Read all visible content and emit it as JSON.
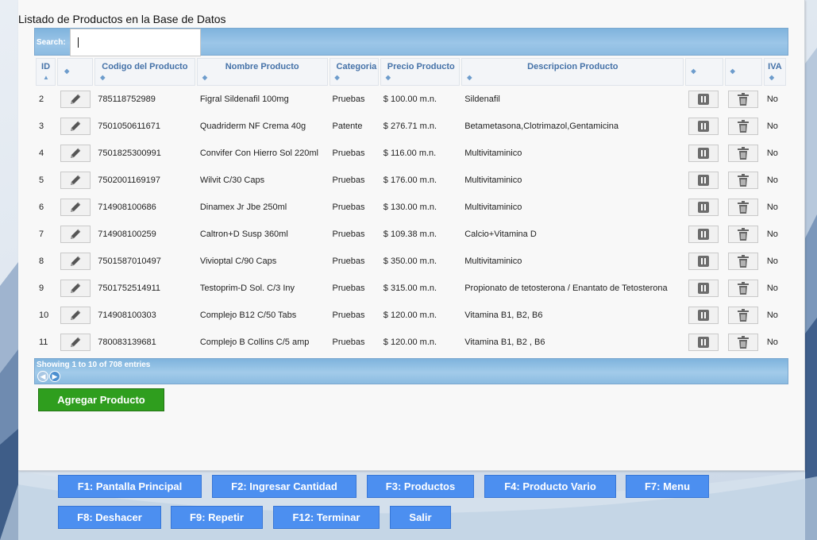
{
  "panel": {
    "title": "Listado de Productos en la Base de Datos",
    "search_label": "Search:",
    "search_value": ""
  },
  "table": {
    "headers": {
      "id": "ID",
      "codigo": "Codigo del Producto",
      "nombre": "Nombre Producto",
      "categoria": "Categoria",
      "precio": "Precio Producto",
      "descripcion": "Descripcion Producto",
      "iva": "IVA"
    },
    "rows": [
      {
        "id": "2",
        "codigo": "785118752989",
        "nombre": "Figral Sildenafil 100mg",
        "categoria": "Pruebas",
        "precio": "$ 100.00 m.n.",
        "descripcion": "Sildenafil",
        "iva": "No"
      },
      {
        "id": "3",
        "codigo": "7501050611671",
        "nombre": "Quadriderm NF Crema 40g",
        "categoria": "Patente",
        "precio": "$ 276.71 m.n.",
        "descripcion": "Betametasona,Clotrimazol,Gentamicina",
        "iva": "No"
      },
      {
        "id": "4",
        "codigo": "7501825300991",
        "nombre": "Convifer Con Hierro Sol 220ml",
        "categoria": "Pruebas",
        "precio": "$ 116.00 m.n.",
        "descripcion": "Multivitaminico",
        "iva": "No"
      },
      {
        "id": "5",
        "codigo": "7502001169197",
        "nombre": "Wilvit C/30 Caps",
        "categoria": "Pruebas",
        "precio": "$ 176.00 m.n.",
        "descripcion": "Multivitaminico",
        "iva": "No"
      },
      {
        "id": "6",
        "codigo": "714908100686",
        "nombre": "Dinamex Jr Jbe 250ml",
        "categoria": "Pruebas",
        "precio": "$ 130.00 m.n.",
        "descripcion": "Multivitaminico",
        "iva": "No"
      },
      {
        "id": "7",
        "codigo": "714908100259",
        "nombre": "Caltron+D Susp 360ml",
        "categoria": "Pruebas",
        "precio": "$ 109.38 m.n.",
        "descripcion": "Calcio+Vitamina D",
        "iva": "No"
      },
      {
        "id": "8",
        "codigo": "7501587010497",
        "nombre": "Vivioptal C/90 Caps",
        "categoria": "Pruebas",
        "precio": "$ 350.00 m.n.",
        "descripcion": "Multivitaminico",
        "iva": "No"
      },
      {
        "id": "9",
        "codigo": "7501752514911",
        "nombre": "Testoprim-D Sol. C/3 Iny",
        "categoria": "Pruebas",
        "precio": "$ 315.00 m.n.",
        "descripcion": "Propionato de tetosterona / Enantato de Tetosterona",
        "iva": "No"
      },
      {
        "id": "10",
        "codigo": "714908100303",
        "nombre": "Complejo B12 C/50 Tabs",
        "categoria": "Pruebas",
        "precio": "$ 120.00 m.n.",
        "descripcion": "Vitamina B1, B2, B6",
        "iva": "No"
      },
      {
        "id": "11",
        "codigo": "780083139681",
        "nombre": "Complejo B Collins C/5 amp",
        "categoria": "Pruebas",
        "precio": "$ 120.00 m.n.",
        "descripcion": "Vitamina B1, B2 , B6",
        "iva": "No"
      }
    ]
  },
  "footer": {
    "entries": "Showing 1 to 10 of 708 entries"
  },
  "add_button": "Agregar Producto",
  "function_keys": [
    {
      "label": "F1: Pantalla Principal"
    },
    {
      "label": "F2: Ingresar Cantidad"
    },
    {
      "label": "F3: Productos"
    },
    {
      "label": "F4: Producto Vario"
    },
    {
      "label": "F7: Menu"
    },
    {
      "label": "F8: Deshacer"
    },
    {
      "label": "F9: Repetir"
    },
    {
      "label": "F12: Terminar"
    },
    {
      "label": "Salir"
    }
  ],
  "icons": {
    "edit": "pencil-icon",
    "pause": "pause-icon",
    "delete": "trash-icon",
    "sort": "sort-icon",
    "prev": "arrow-left-icon",
    "next": "arrow-right-icon"
  },
  "colors": {
    "header_blue": "#8bbbe1",
    "add_green": "#2f9e1e",
    "fkey_blue": "#4c8ff0"
  }
}
